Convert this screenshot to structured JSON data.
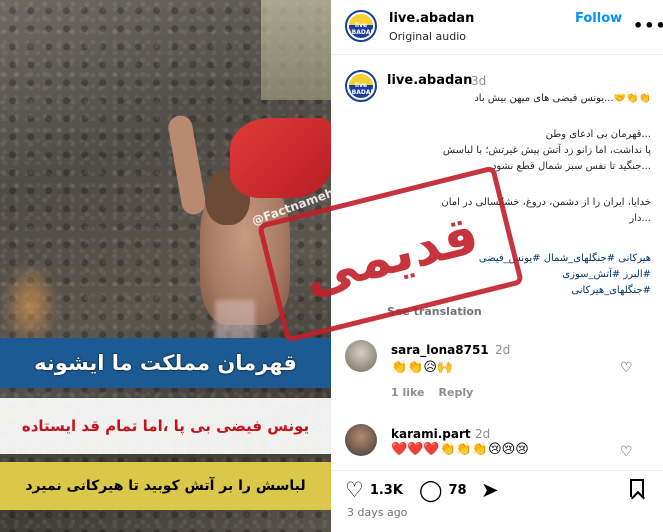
{
  "media": {
    "watermark": "@Factnameh",
    "caption_line1": "قهرمان مملکت ما ایشونه",
    "caption_line2": "یونس فیضی بی پا ،اما  تمام قد ایستاده",
    "caption_line3": "لباسش را بر  آتش کوبید تا هیرکانی نمیرد"
  },
  "header": {
    "username": "live.abadan",
    "subtitle": "Original audio",
    "follow_label": "Follow",
    "more_label": "•••",
    "avatar_text": "live ABADAN"
  },
  "post": {
    "username": "live.abadan",
    "time": "3d",
    "line1": "👏👏🤝...یونس فیضی های میهن بیش باد",
    "line2": "...قهرمان بی ادعای وطن",
    "line3": "پا نداشت، اما زانو زد آتش پیش غیرتش؛ با لباسش",
    "line4": "...جنگید تا نفس سبز شمال قطع نشود",
    "line5": "خدایا، ایران را از دشمن، دروغ، خشکسالی در امان",
    "line6": "...دار",
    "hashtags1": "هیرکانی  #جنگلهای_شمال  #یونس_فیضی",
    "hashtags2": "#البرز  #آتش_سوزی",
    "hashtags3": "#جنگلهای_هیرکانی",
    "see_translation": "See translation"
  },
  "stamp": {
    "text": "قدیمی",
    "color": "#c31f2a"
  },
  "comments": [
    {
      "user": "sara_lona8751",
      "time": "2d",
      "text": "👏👏😥🙌",
      "likes": "1 like",
      "reply": "Reply"
    },
    {
      "user": "karami.part",
      "time": "2d",
      "text": "❤️❤️❤️👏👏👏😢😢😢"
    }
  ],
  "actions": {
    "like_count": "1.3K",
    "comment_count": "78",
    "posted_ago": "3 days ago"
  },
  "icons": [
    "more-icon",
    "heart-icon",
    "comment-icon",
    "share-icon",
    "bookmark-icon"
  ],
  "colors": {
    "follow": "#0095f6",
    "stamp": "#c31f2a",
    "caption_bar": "#1d5a94"
  }
}
